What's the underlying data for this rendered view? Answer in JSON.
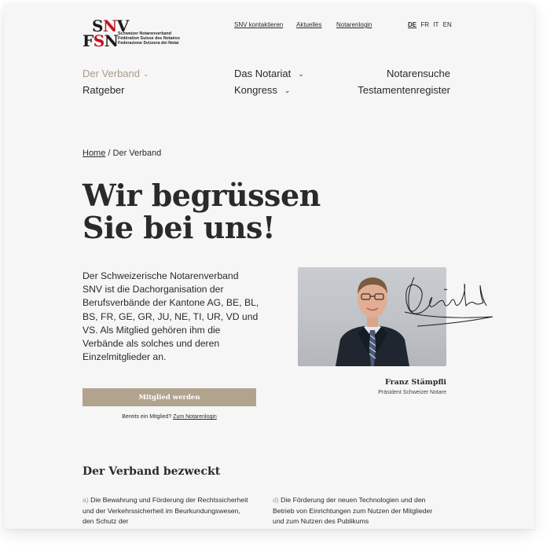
{
  "logo": {
    "line1": "SNV",
    "line2": "FSN",
    "sub1": "Schweizer Notarenverband",
    "sub2": "Fédération Suisse des Notaires",
    "sub3": "Federazione Svizzera dei Notai"
  },
  "toplinks": [
    "SNV kontaktieren",
    "Aktuelles",
    "Notarenlogin"
  ],
  "languages": {
    "active": "DE",
    "others": [
      "FR",
      "IT",
      "EN"
    ]
  },
  "nav": {
    "verband": "Der Verband",
    "notariat": "Das Notariat",
    "notarensuche": "Notarensuche",
    "ratgeber": "Ratgeber",
    "kongress": "Kongress",
    "testament": "Testamentenregister"
  },
  "breadcrumb": {
    "home": "Home",
    "separator": " / ",
    "current": "Der Verband"
  },
  "headline": {
    "line1": "Wir begrüssen",
    "line2": "Sie bei uns!"
  },
  "intro": "Der Schweizerische Notarenverband SNV ist die Dachorganisation der Berufsverbände der Kantone AG, BE, BL, BS, FR, GE, GR, JU, NE, TI, UR, VD und VS. Als Mitglied gehören ihm die Verbände als solches und deren Einzelmitglieder an.",
  "president": {
    "name": "Franz Stämpfli",
    "role": "Präsident Schweizer Notare"
  },
  "cta": {
    "button": "Mitglied werden",
    "member_text": "Bereits ein Mitglied? ",
    "member_link": "Zum Notarenlogin"
  },
  "section": {
    "title": "Der Verband bezweckt",
    "items": [
      {
        "letter": "a)",
        "text": " Die Bewahrung und Förderung der Rechtssicherheit und der Verkehrssicherheit im Beurkundungswesen, den Schutz der"
      },
      {
        "letter": "d)",
        "text": " Die Förderung der neuen Technologien und den Betrieb von Einrichtungen zum Nutzen der Mitglieder und zum Nutzen des Publikums"
      }
    ]
  },
  "colors": {
    "accent": "#a99a86",
    "button": "#b2a38f",
    "logo_red": "#c3121e"
  }
}
